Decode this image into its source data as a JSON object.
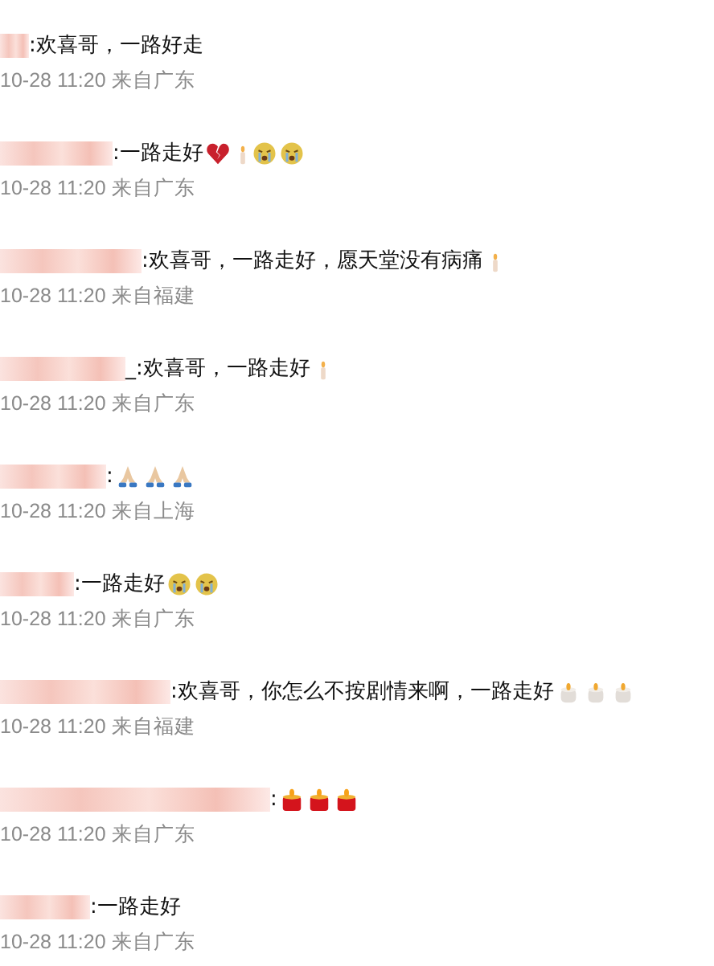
{
  "comments": [
    {
      "text": ":欢喜哥，一路好走",
      "meta": "10-28 11:20 来自广东"
    },
    {
      "text": ":一路走好",
      "emojis": [
        {
          "kind": "broken-heart"
        },
        {
          "kind": "small-candle"
        },
        {
          "kind": "crying-face"
        },
        {
          "kind": "crying-face"
        }
      ],
      "meta": "10-28 11:20 来自广东"
    },
    {
      "text": ":欢喜哥，一路走好，愿天堂没有病痛",
      "emojis": [
        {
          "kind": "small-candle"
        }
      ],
      "meta": "10-28 11:20 来自福建"
    },
    {
      "text": "_:欢喜哥，一路走好",
      "emojis": [
        {
          "kind": "small-candle"
        }
      ],
      "meta": "10-28 11:20 来自广东"
    },
    {
      "text": ":",
      "emojis": [
        {
          "kind": "praying-hands"
        },
        {
          "kind": "praying-hands"
        },
        {
          "kind": "praying-hands"
        }
      ],
      "meta": "10-28 11:20 来自上海"
    },
    {
      "text": ":一路走好",
      "emojis": [
        {
          "kind": "crying-face"
        },
        {
          "kind": "crying-face"
        }
      ],
      "meta": "10-28 11:20 来自广东"
    },
    {
      "text": ":欢喜哥，你怎么不按剧情来啊，一路走好",
      "emojis": [
        {
          "kind": "candle"
        },
        {
          "kind": "candle"
        },
        {
          "kind": "candle"
        }
      ],
      "meta": "10-28 11:20 来自福建"
    },
    {
      "text": ":",
      "emojis": [
        {
          "kind": "red-candle"
        },
        {
          "kind": "red-candle"
        },
        {
          "kind": "red-candle"
        }
      ],
      "meta": "10-28 11:20 来自广东"
    },
    {
      "text": ":一路走好",
      "meta": "10-28 11:20 来自广东"
    }
  ]
}
